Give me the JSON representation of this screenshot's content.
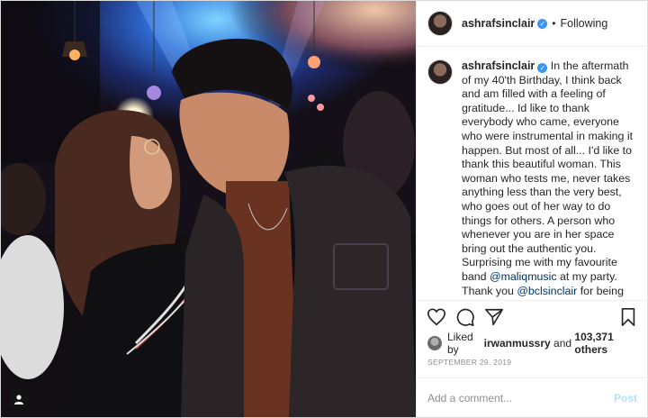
{
  "header": {
    "username": "ashrafsinclair",
    "verified_icon": "verified-badge-icon",
    "separator": "•",
    "follow_label": "Following"
  },
  "caption": {
    "username": "ashrafsinclair",
    "text_1": "In the aftermath of my 40'th Birthday, I think back and am filled with a feeling of gratitude... Id like to thank everybody who came, everyone who were instrumental in making it happen. But most of all... I'd like to thank this beautiful woman. This woman who tests me, never takes anything less than the very best, who goes out of her way to do things for others. A person who whenever you are in her space bring out the authentic you. Surprising me with my favourite band ",
    "mention_1": "@maliqmusic",
    "text_2": " at my party. Thank you ",
    "mention_2": "@bclsinclair",
    "text_3": " for being that wonderful, challenging and loving presence in my life. My wife,"
  },
  "actions": {
    "icons": [
      "heart-icon",
      "comment-icon",
      "share-icon",
      "bookmark-icon"
    ]
  },
  "likes": {
    "prefix": "Liked by",
    "liker": "irwanmussry",
    "conjunction": "and",
    "others": "103,371 others"
  },
  "date": "SEPTEMBER 29, 2019",
  "comment": {
    "placeholder": "Add a comment...",
    "post_label": "Post"
  },
  "photo": {
    "user_tag_icon": "person-icon"
  },
  "colors": {
    "verified": "#3897f0",
    "mention": "#003569",
    "post_disabled": "#b2dffc",
    "border": "#dbdbdb"
  }
}
